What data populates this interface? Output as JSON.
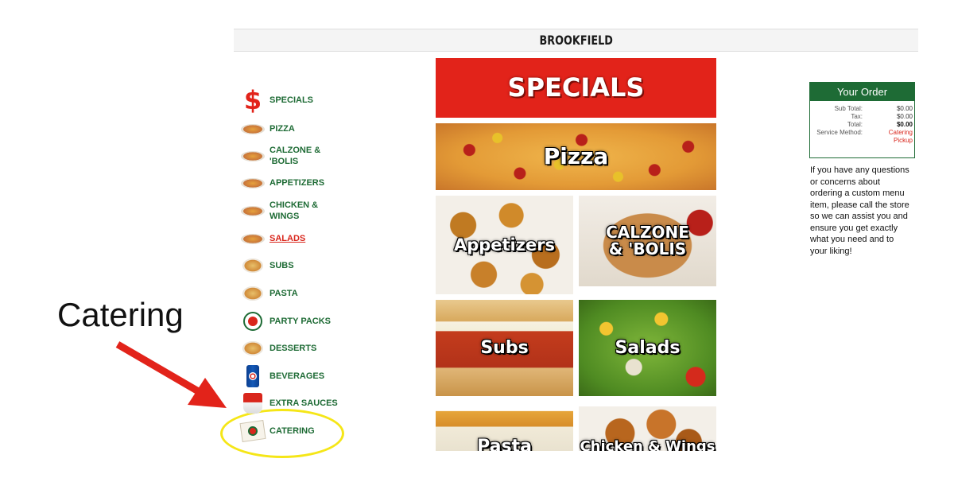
{
  "annotation": {
    "label": "Catering",
    "arrow_color": "#e2231a",
    "circle_color": "#f5e617"
  },
  "header": {
    "store_name": "BROOKFIELD"
  },
  "sidebar": {
    "items": [
      {
        "label": "SPECIALS",
        "icon": "dollar-icon"
      },
      {
        "label": "PIZZA",
        "icon": "pizza-icon"
      },
      {
        "label": "CALZONE &",
        "label2": "'BOLIS",
        "icon": "calzone-icon"
      },
      {
        "label": "APPETIZERS",
        "icon": "appetizers-icon"
      },
      {
        "label": "CHICKEN &",
        "label2": "WINGS",
        "icon": "wings-icon"
      },
      {
        "label": "SALADS",
        "icon": "salad-icon",
        "active": true
      },
      {
        "label": "SUBS",
        "icon": "sub-icon"
      },
      {
        "label": "PASTA",
        "icon": "pasta-icon"
      },
      {
        "label": "PARTY PACKS",
        "icon": "party-pack-icon"
      },
      {
        "label": "DESSERTS",
        "icon": "dessert-icon"
      },
      {
        "label": "BEVERAGES",
        "icon": "soda-can-icon"
      },
      {
        "label": "EXTRA SAUCES",
        "icon": "sauce-cup-icon"
      },
      {
        "label": "CATERING",
        "icon": "catering-box-icon"
      }
    ]
  },
  "main": {
    "tiles": {
      "specials": "SPECIALS",
      "pizza": "Pizza",
      "appetizers": "Appetizers",
      "calzone_line1": "CALZONE",
      "calzone_line2": "& 'BOLIS",
      "subs": "Subs",
      "salads": "Salads",
      "pasta": "Pasta",
      "chicken": "Chicken & Wings"
    }
  },
  "order": {
    "title": "Your Order",
    "rows": [
      {
        "key": "Sub Total:",
        "value": "$0.00"
      },
      {
        "key": "Tax:",
        "value": "$0.00"
      },
      {
        "key": "Total:",
        "value": "$0.00"
      },
      {
        "key": "Service Method:",
        "value": "Catering",
        "value2": "Pickup"
      }
    ],
    "note": "If you have any questions or concerns about ordering a custom menu item, please call the store so we can assist you and ensure you get exactly what you need and to your liking!"
  },
  "colors": {
    "brand_green": "#1e6b35",
    "brand_red": "#e2231a"
  }
}
